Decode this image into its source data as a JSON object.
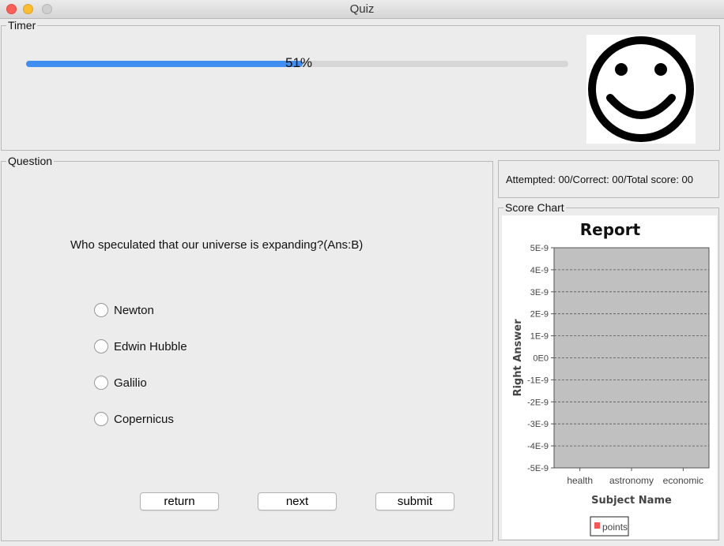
{
  "window": {
    "title": "Quiz"
  },
  "timer": {
    "legend": "Timer",
    "progress_percent": 51,
    "progress_label": "51%",
    "fill_color": "#3f8ef0",
    "status_icon": "smiley-face-icon"
  },
  "question": {
    "legend": "Question",
    "text": "Who speculated that our universe is expanding?(Ans:B)",
    "options": [
      {
        "label": "Newton",
        "selected": false
      },
      {
        "label": "Edwin Hubble",
        "selected": false
      },
      {
        "label": "Galilio",
        "selected": false
      },
      {
        "label": "Copernicus",
        "selected": false
      }
    ],
    "buttons": {
      "return_label": "return",
      "next_label": "next",
      "submit_label": "submit"
    }
  },
  "score": {
    "summary": "Attempted: 00/Correct: 00/Total score: 00"
  },
  "score_chart": {
    "legend": "Score Chart"
  },
  "chart_data": {
    "type": "bar",
    "title": "Report",
    "xlabel": "Subject Name",
    "ylabel": "Right Answer",
    "categories": [
      "health",
      "astronomy",
      "economic"
    ],
    "series": [
      {
        "name": "points",
        "values": [
          0,
          0,
          0
        ],
        "color": "#ff5555"
      }
    ],
    "yticks": [
      "5E-9",
      "4E-9",
      "3E-9",
      "2E-9",
      "1E-9",
      "0E0",
      "-1E-9",
      "-2E-9",
      "-3E-9",
      "-4E-9",
      "-5E-9"
    ],
    "ylim": [
      -5e-09,
      5e-09
    ],
    "grid": true,
    "plot_background": "#c0c0c0",
    "legend_position": "bottom"
  }
}
